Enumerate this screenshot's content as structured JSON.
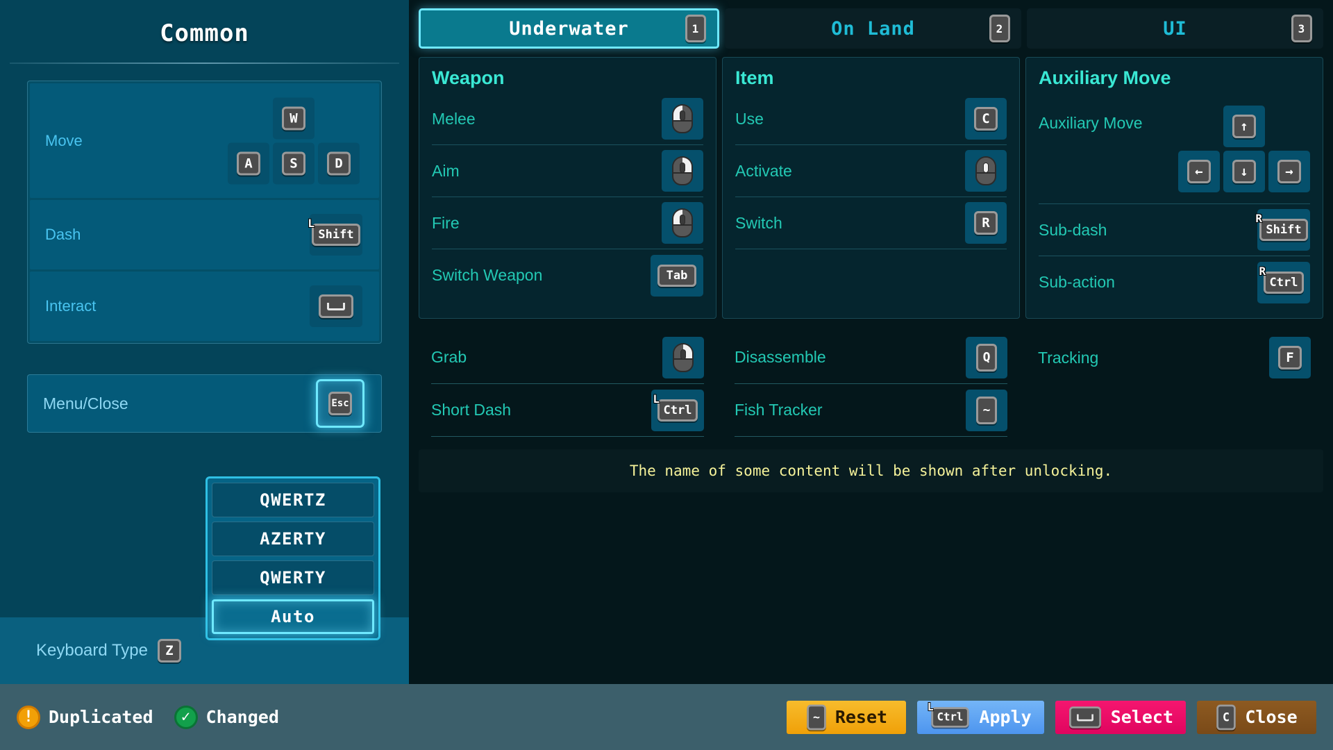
{
  "left": {
    "title": "Common",
    "bindings": [
      {
        "label": "Move",
        "keys": [
          "W",
          "A",
          "S",
          "D"
        ],
        "type": "wasd"
      },
      {
        "label": "Dash",
        "key": "Shift",
        "mod": "L",
        "type": "wide"
      },
      {
        "label": "Interact",
        "key": "Space",
        "type": "space"
      }
    ],
    "menu": {
      "label": "Menu/Close",
      "key": "Esc",
      "selected": true
    },
    "keyboard_type": {
      "label": "Keyboard Type",
      "hotkey": "Z",
      "options": [
        "QWERTZ",
        "AZERTY",
        "QWERTY",
        "Auto"
      ],
      "selected": "Auto"
    }
  },
  "tabs": [
    {
      "label": "Underwater",
      "hotkey": "1",
      "active": true
    },
    {
      "label": "On Land",
      "hotkey": "2",
      "active": false
    },
    {
      "label": "UI",
      "hotkey": "3",
      "active": false
    }
  ],
  "columns": [
    {
      "title": "Weapon",
      "rows": [
        {
          "label": "Melee",
          "key": "mouse-left",
          "type": "mouse"
        },
        {
          "label": "Aim",
          "key": "mouse-right",
          "type": "mouse"
        },
        {
          "label": "Fire",
          "key": "mouse-left",
          "type": "mouse"
        },
        {
          "label": "Switch Weapon",
          "key": "Tab",
          "type": "wide"
        }
      ]
    },
    {
      "title": "Item",
      "rows": [
        {
          "label": "Use",
          "key": "C",
          "type": "square"
        },
        {
          "label": "Activate",
          "key": "mouse-middle",
          "type": "mouse"
        },
        {
          "label": "Switch",
          "key": "R",
          "type": "square"
        }
      ]
    },
    {
      "title": "Auxiliary Move",
      "aux": {
        "label": "Auxiliary Move",
        "keys": [
          "↑",
          "←",
          "↓",
          "→"
        ]
      },
      "rows": [
        {
          "label": "Sub-dash",
          "key": "Shift",
          "mod": "R",
          "type": "wide"
        },
        {
          "label": "Sub-action",
          "key": "Ctrl",
          "mod": "R",
          "type": "wide"
        }
      ]
    }
  ],
  "lower": [
    {
      "label": "Grab",
      "key": "mouse-right",
      "type": "mouse"
    },
    {
      "label": "Short Dash",
      "key": "Ctrl",
      "mod": "L",
      "type": "wide"
    },
    {
      "label": "Disassemble",
      "key": "Q",
      "type": "tall"
    },
    {
      "label": "Fish Tracker",
      "key": "~",
      "type": "tall"
    },
    {
      "label": "Tracking",
      "key": "F",
      "type": "square"
    }
  ],
  "notice": "The name of some content will be shown after unlocking.",
  "bottom": {
    "legend": [
      {
        "label": "Duplicated",
        "glyph": "!",
        "color": "#f2a007"
      },
      {
        "label": "Changed",
        "glyph": "✓",
        "color": "#12a04b"
      }
    ],
    "actions": [
      {
        "label": "Reset",
        "hotkey": "~",
        "hotkey_type": "tall",
        "color": "#f0a008"
      },
      {
        "label": "Apply",
        "hotkey": "Ctrl",
        "mod": "L",
        "hotkey_type": "wide",
        "color": "#4d95ef"
      },
      {
        "label": "Select",
        "hotkey": "Space",
        "hotkey_type": "space",
        "color": "#e0055f"
      },
      {
        "label": "Close",
        "hotkey": "C",
        "hotkey_type": "tall",
        "color": "#7a4a18"
      }
    ]
  }
}
